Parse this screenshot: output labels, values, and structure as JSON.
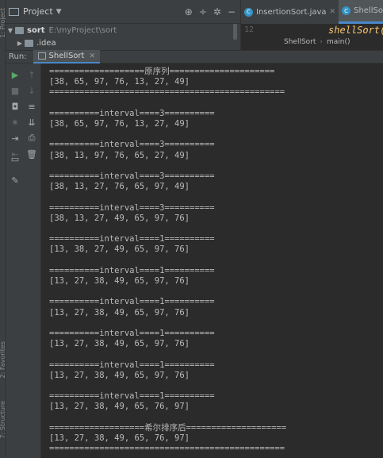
{
  "project_pane": {
    "title": "Project",
    "tree": [
      {
        "name": "sort",
        "path": "E:\\myProject\\sort"
      },
      {
        "name": ".idea"
      }
    ]
  },
  "editor": {
    "tabs": [
      {
        "label": "InsertionSort.java"
      },
      {
        "label": "ShellSort"
      }
    ],
    "line_number": "12",
    "code": "shellSort(",
    "breadcrumb": [
      "ShellSort",
      "main()"
    ]
  },
  "run": {
    "label": "Run:",
    "tab": "ShellSort"
  },
  "left_strip": [
    "1: Project",
    "2: Favorites",
    "7: Structure"
  ],
  "console": {
    "lines": [
      "===================原序列=====================",
      "[38, 65, 97, 76, 13, 27, 49]",
      "===============================================",
      "",
      "==========interval====3==========",
      "[38, 65, 97, 76, 13, 27, 49]",
      "",
      "==========interval====3==========",
      "[38, 13, 97, 76, 65, 27, 49]",
      "",
      "==========interval====3==========",
      "[38, 13, 27, 76, 65, 97, 49]",
      "",
      "==========interval====3==========",
      "[38, 13, 27, 49, 65, 97, 76]",
      "",
      "==========interval====1==========",
      "[13, 38, 27, 49, 65, 97, 76]",
      "",
      "==========interval====1==========",
      "[13, 27, 38, 49, 65, 97, 76]",
      "",
      "==========interval====1==========",
      "[13, 27, 38, 49, 65, 97, 76]",
      "",
      "==========interval====1==========",
      "[13, 27, 38, 49, 65, 97, 76]",
      "",
      "==========interval====1==========",
      "[13, 27, 38, 49, 65, 97, 76]",
      "",
      "==========interval====1==========",
      "[13, 27, 38, 49, 65, 76, 97]",
      "",
      "===================希尔排序后====================",
      "[13, 27, 38, 49, 65, 76, 97]",
      "==============================================="
    ]
  },
  "colors": {
    "background": "#2b2b2b",
    "panel": "#3c3f41",
    "accent": "#4a88c7",
    "run_green": "#59a869",
    "code_method": "#ffc66d"
  }
}
